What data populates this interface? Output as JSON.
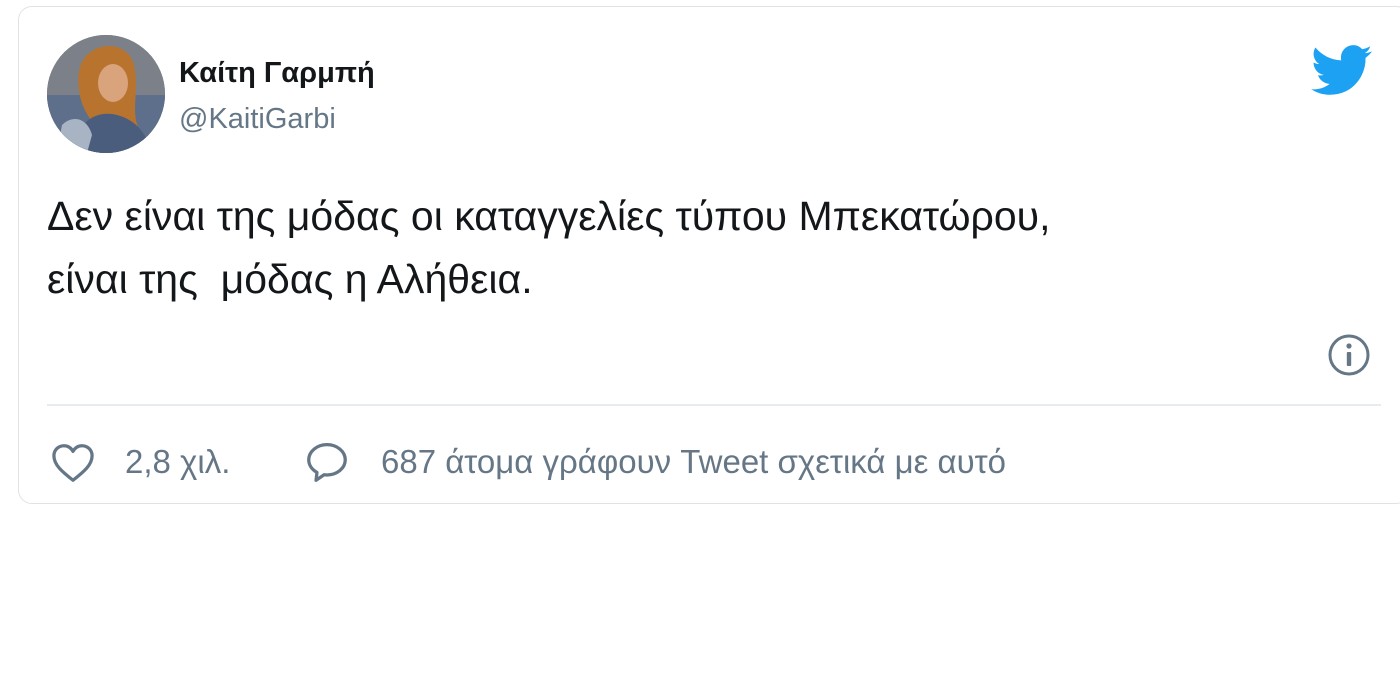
{
  "tweet": {
    "author": {
      "name": "Καίτη Γαρμπή",
      "handle": "@KaitiGarbi"
    },
    "text_lines": [
      "Δεν είναι της μόδας οι καταγγελίες τύπου Μπεκατώρου,",
      "είναι της  μόδας η Αλήθεια."
    ],
    "likes": "2,8 χιλ.",
    "replies": "687 άτομα γράφουν Tweet σχετικά με αυτό"
  },
  "icons": {
    "brand": "twitter-bird-icon",
    "info": "info-icon",
    "like": "heart-icon",
    "reply": "speech-bubble-icon"
  },
  "colors": {
    "brand_blue": "#1da1f2",
    "name_text": "#14171a",
    "secondary_text": "#657786",
    "border": "#dfe3e6"
  }
}
